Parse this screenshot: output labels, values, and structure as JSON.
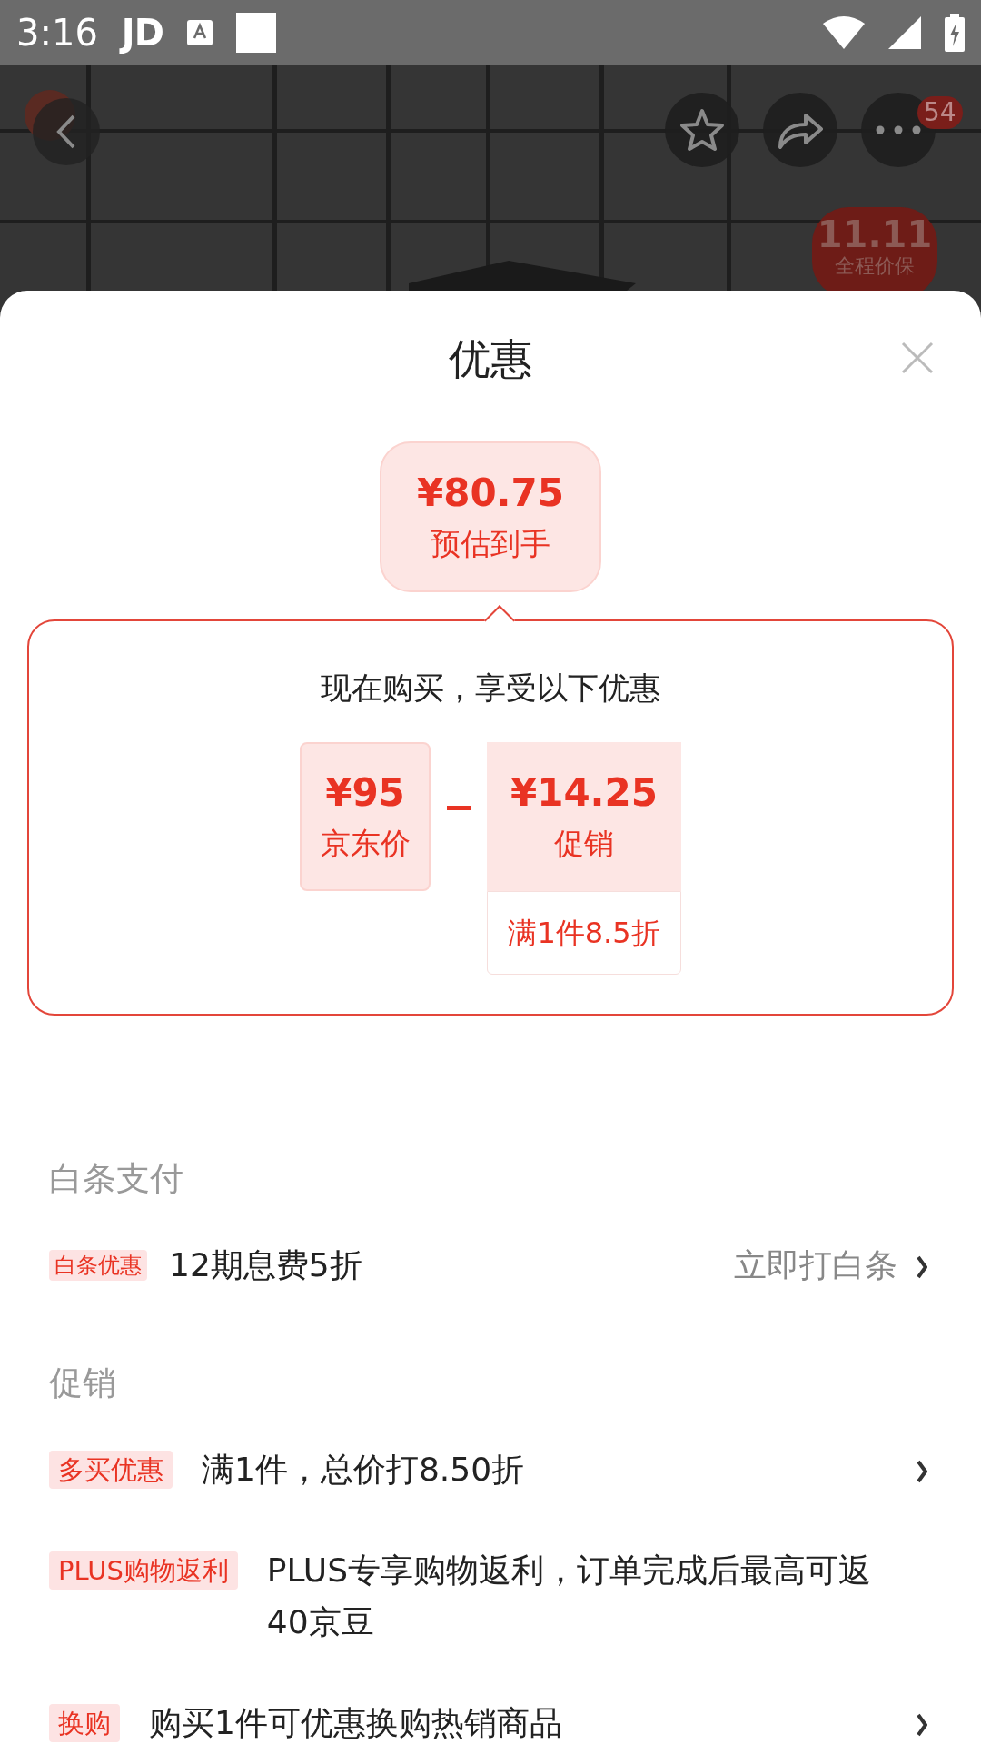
{
  "status_bar": {
    "time": "3:16",
    "app": "JD"
  },
  "top_bar": {
    "menu_badge": "54",
    "promo_badge": {
      "title": "11.11",
      "subtitle": "全程价保"
    }
  },
  "sheet": {
    "title": "优惠",
    "estimate": {
      "price": "¥80.75",
      "label": "预估到手"
    },
    "breakdown": {
      "heading": "现在购买，享受以下优惠",
      "items": [
        {
          "kind": "base",
          "price": "¥95",
          "label": "京东价"
        },
        {
          "kind": "discount",
          "price": "¥14.25",
          "label": "促销",
          "note": "满1件8.5折"
        }
      ]
    },
    "sections": [
      {
        "title": "白条支付",
        "rows": [
          {
            "tag": "白条优惠",
            "kind": "small",
            "text": "12期息费5折",
            "link": "立即打白条",
            "arrow": true
          }
        ]
      },
      {
        "title": "促销",
        "rows": [
          {
            "tag": "多买优惠",
            "kind": "large",
            "text": "满1件，总价打8.50折",
            "arrow": true
          },
          {
            "tag": "PLUS购物返利",
            "kind": "large",
            "text": "PLUS专享购物返利，订单完成后最高可返40京豆",
            "arrow": false
          },
          {
            "tag": "换购",
            "kind": "large",
            "text": "购买1件可优惠换购热销商品",
            "arrow": true
          }
        ]
      }
    ]
  }
}
